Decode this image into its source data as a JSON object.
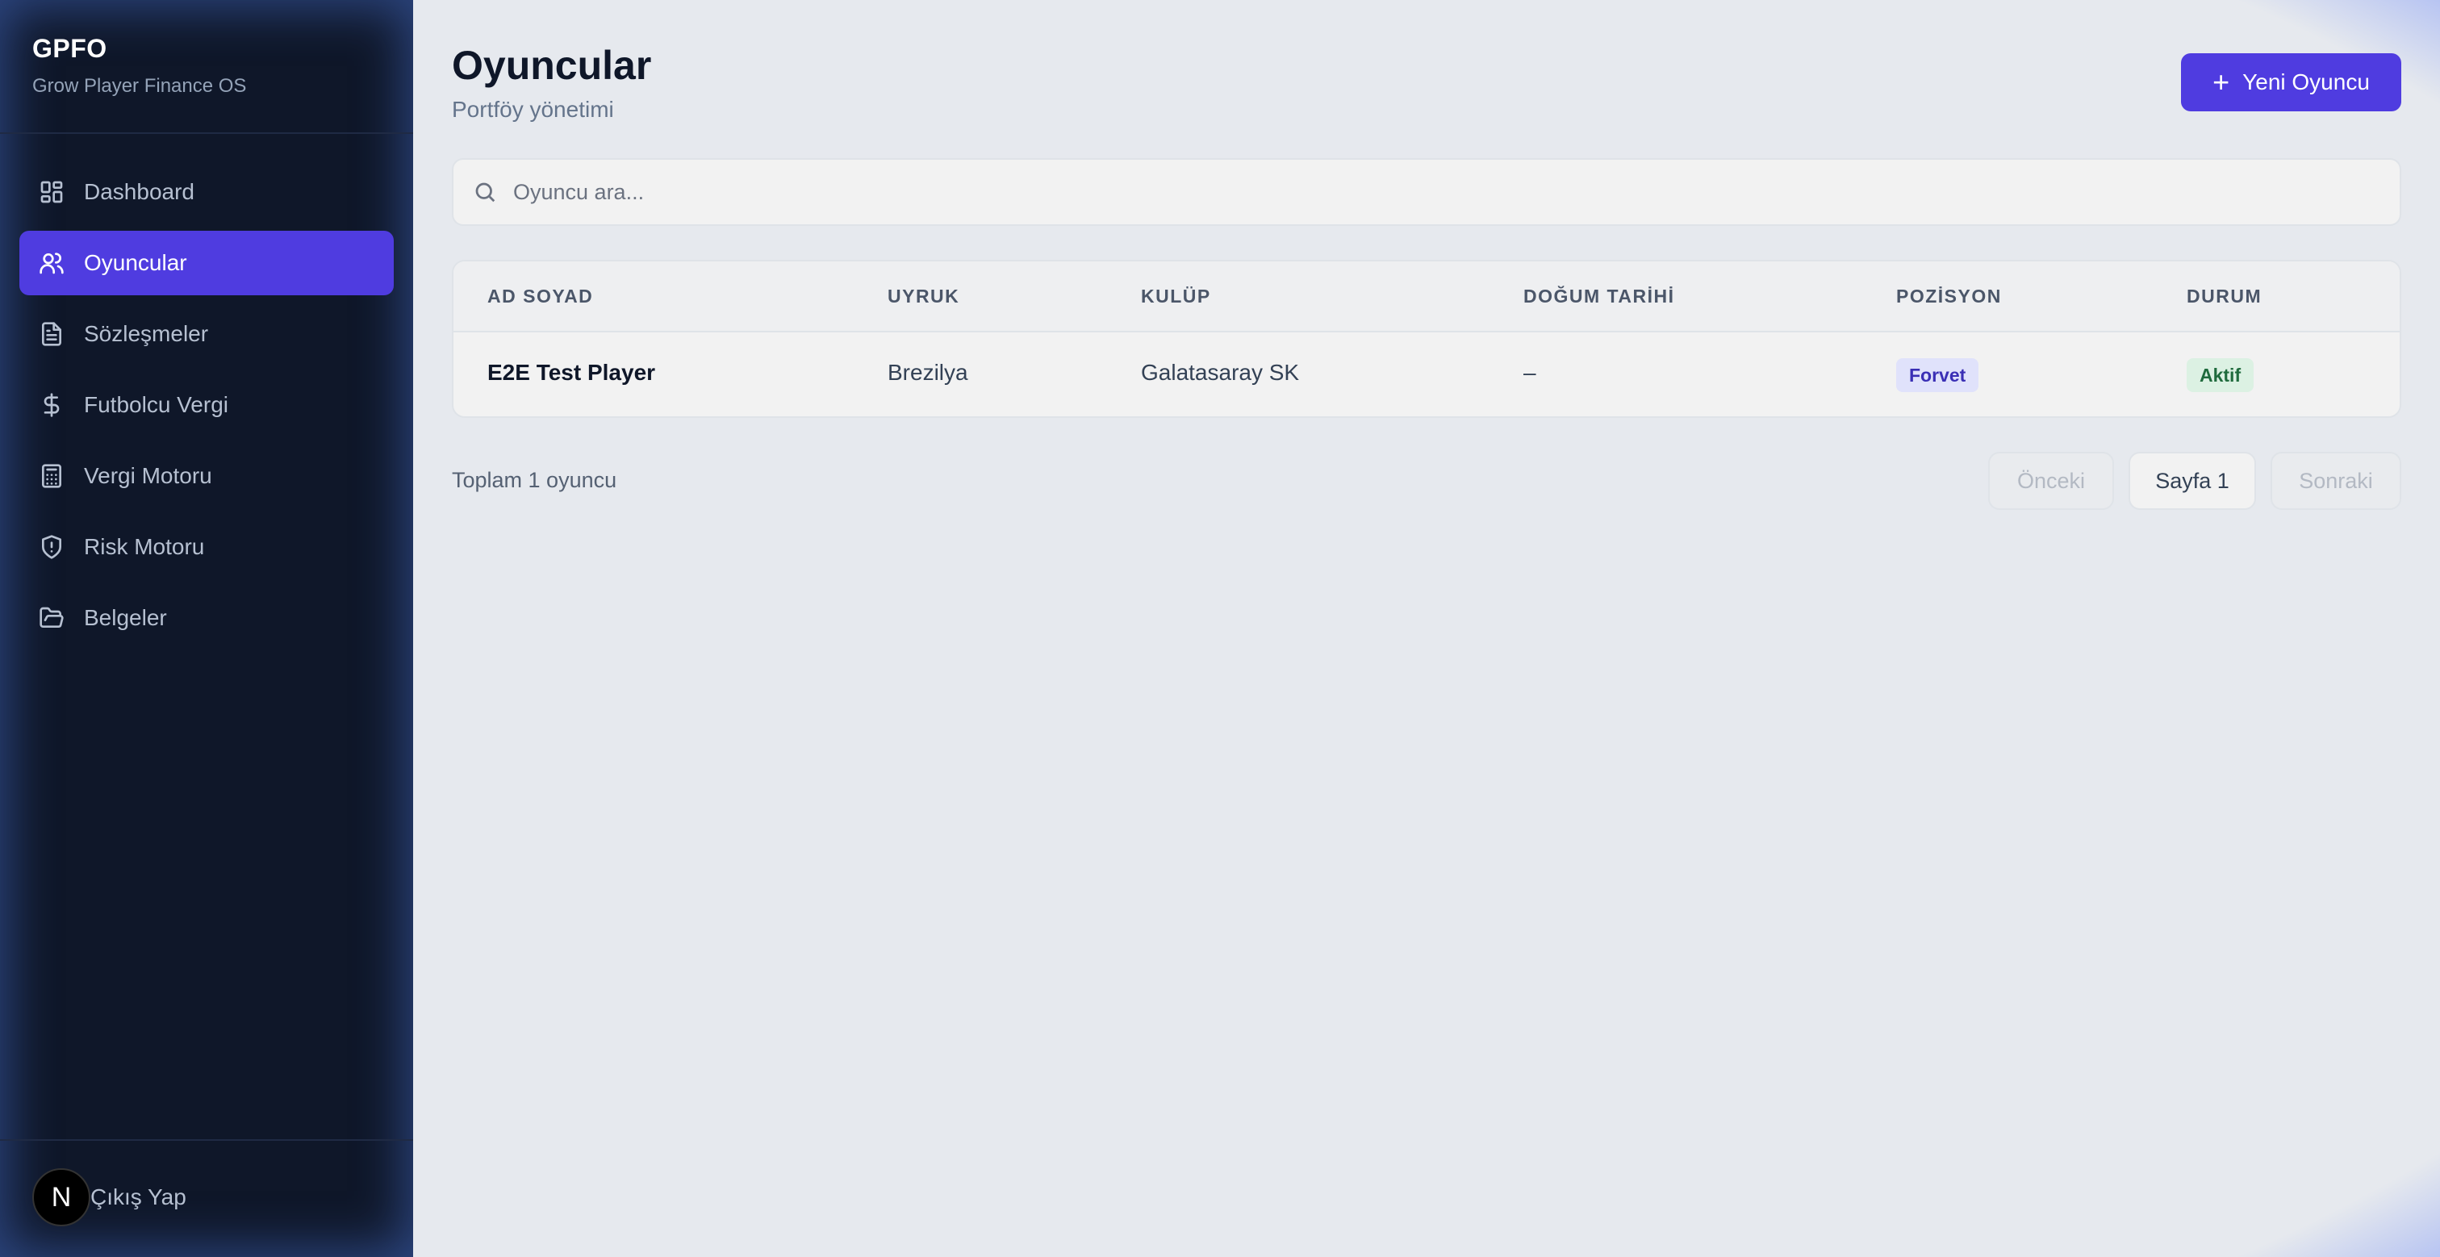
{
  "sidebar": {
    "brand_title": "GPFO",
    "brand_subtitle": "Grow Player Finance OS",
    "items": [
      {
        "label": "Dashboard",
        "icon": "dashboard-icon",
        "active": false
      },
      {
        "label": "Oyuncular",
        "icon": "users-icon",
        "active": true
      },
      {
        "label": "Sözleşmeler",
        "icon": "document-icon",
        "active": false
      },
      {
        "label": "Futbolcu Vergi",
        "icon": "dollar-icon",
        "active": false
      },
      {
        "label": "Vergi Motoru",
        "icon": "calculator-icon",
        "active": false
      },
      {
        "label": "Risk Motoru",
        "icon": "shield-icon",
        "active": false
      },
      {
        "label": "Belgeler",
        "icon": "folder-open-icon",
        "active": false
      }
    ],
    "logout_label": "Çıkış Yap",
    "avatar_letter": "N"
  },
  "header": {
    "title": "Oyuncular",
    "subtitle": "Portföy yönetimi",
    "new_button_label": "Yeni Oyuncu"
  },
  "search": {
    "placeholder": "Oyuncu ara..."
  },
  "table": {
    "columns": [
      "AD SOYAD",
      "UYRUK",
      "KULÜP",
      "DOĞUM TARİHİ",
      "POZİSYON",
      "DURUM"
    ],
    "rows": [
      {
        "name": "E2E Test Player",
        "nationality": "Brezilya",
        "club": "Galatasaray SK",
        "birth_date": "–",
        "position": "Forvet",
        "status": "Aktif"
      }
    ]
  },
  "footer": {
    "total_label": "Toplam 1 oyuncu",
    "prev_label": "Önceki",
    "page_label": "Sayfa 1",
    "next_label": "Sonraki"
  },
  "colors": {
    "accent": "#4f3ce0",
    "sidebar_bg": "#0f1729",
    "content_bg": "#e6e9ee"
  }
}
